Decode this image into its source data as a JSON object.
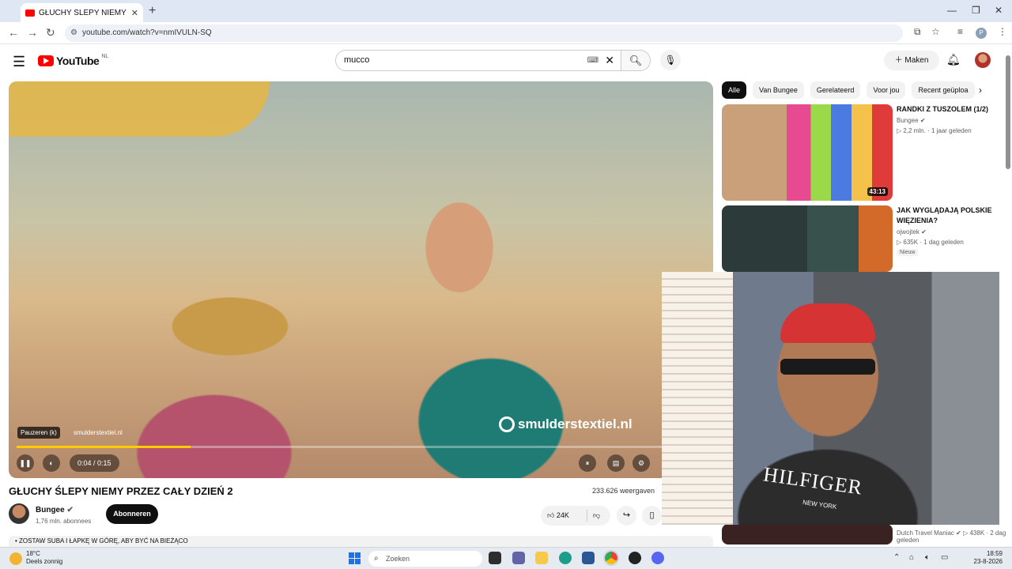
{
  "browser": {
    "tab_title": "GŁUCHY ŚLEPY NIEMY PRZ...",
    "tab_close": "✕",
    "new_tab": "+",
    "url": "youtube.com/watch?v=nmIVULN-SQ",
    "window_controls": [
      "—",
      "❐",
      "✕"
    ]
  },
  "youtube": {
    "logo_text": "YouTube",
    "region": "NL",
    "search_value": "mucco",
    "create_label": "Maken"
  },
  "player": {
    "watermark": "smulderstextiel.nl",
    "tooltip": "Pauzeren (k)",
    "ad_label": "smulderstextiel.nl",
    "time": "0:04 / 0:15",
    "progress": 0.27
  },
  "video": {
    "title": "GŁUCHY ŚLEPY NIEMY PRZEZ CAŁY DZIEŃ 2",
    "views": "233.626 weergaven",
    "channel": "Bungee",
    "subscribers": "1,76 mln. abonnees",
    "subscribe_label": "Abonneren",
    "likes": "24K",
    "description_snippet": "• ZOSTAW SUBA I ŁAPKĘ W GÓRĘ, ABY BYĆ NA BIEŻĄCO"
  },
  "rail": {
    "chips": [
      "Alle",
      "Van Bungee",
      "Gerelateerd",
      "Voor jou",
      "Recent geüploa"
    ],
    "videos": [
      {
        "title": "RANDKI Z TUSZOLEM (1/2)",
        "channel": "Bungee",
        "meta": "▷ 2,2 mln. · 1 jaar geleden",
        "duration": "43:13"
      },
      {
        "title": "JAK WYGLĄDAJĄ POLSKIE WIĘZIENIA?",
        "channel": "ojwojtek",
        "meta": "▷ 635K · 1 dag geleden",
        "badge": "Nieuw"
      },
      {
        "channel": "Dutch Travel Maniac",
        "meta": "▷ 438K · 2 dag geleden"
      }
    ]
  },
  "webcam": {
    "shirt_brand": "HILFIGER",
    "shirt_sub": "NEW YORK"
  },
  "taskbar": {
    "temperature": "18°C",
    "weather": "Deels zonnig",
    "search_placeholder": "Zoeken",
    "time": "18:59",
    "date": "23-8-2026"
  }
}
